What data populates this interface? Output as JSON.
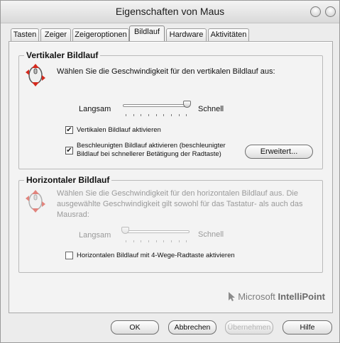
{
  "window": {
    "title": "Eigenschaften von Maus"
  },
  "tabs": [
    {
      "label": "Tasten"
    },
    {
      "label": "Zeiger"
    },
    {
      "label": "Zeigeroptionen"
    },
    {
      "label": "Bildlauf"
    },
    {
      "label": "Hardware"
    },
    {
      "label": "Aktivitäten"
    }
  ],
  "vertical": {
    "title": "Vertikaler Bildlauf",
    "description": "Wählen Sie die Geschwindigkeit für den vertikalen Bildlauf aus:",
    "slider_min": "Langsam",
    "slider_max": "Schnell",
    "speed_level": 1.0,
    "checkbox1": {
      "label": "Vertikalen Bildlauf aktivieren",
      "checked": true
    },
    "checkbox2": {
      "label1": "Beschleunigten Bildlauf aktivieren (beschleunigter",
      "label2": "Bildlauf bei schnellerer Betätigung der Radtaste)",
      "checked": true
    },
    "advanced_button": "Erweitert..."
  },
  "horizontal": {
    "title": "Horizontaler Bildlauf",
    "description1": "Wählen Sie die Geschwindigkeit für den horizontalen Bildlauf aus. Die",
    "description2": "ausgewählte Geschwindigkeit gilt sowohl für das Tastatur- als auch das",
    "description3": "Mausrad:",
    "slider_min": "Langsam",
    "slider_max": "Schnell",
    "speed_level": 0.0,
    "checkbox": {
      "label": "Horizontalen Bildlauf mit 4-Wege-Radtaste aktivieren",
      "checked": false
    }
  },
  "brand": {
    "company": "Microsoft",
    "product": "IntelliPoint"
  },
  "buttons": {
    "ok": "OK",
    "cancel": "Abbrechen",
    "apply": "Übernehmen",
    "help": "Hilfe"
  }
}
